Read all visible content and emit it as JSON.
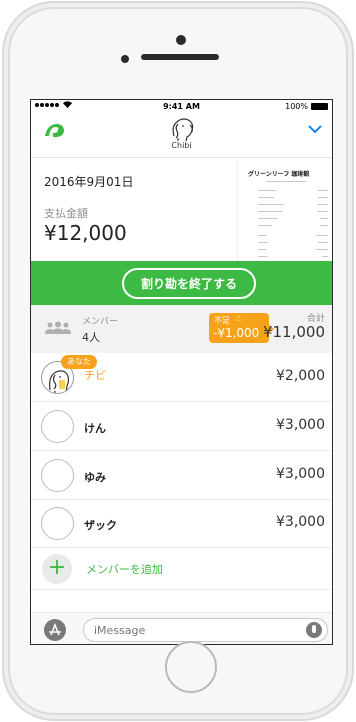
{
  "status": {
    "time": "9:41 AM",
    "battery": "100%",
    "wifi_icon": "wifi-icon"
  },
  "header": {
    "title": "Chibi",
    "icons": [
      "chibi-app-icon",
      "elephant-icon",
      "chevron-down-icon"
    ]
  },
  "receipt": {
    "date": "2016年9月01日",
    "pay_label": "支払金額",
    "pay_amount": "¥12,000",
    "thumbnail_title": "グリーンリーフ 珈琲館"
  },
  "action": {
    "end_button_label": "割り勘を終了する"
  },
  "summary": {
    "members_label": "メンバー",
    "members_count": "4人",
    "shortage_label": "不足",
    "shortage_amount": "-¥1,000",
    "total_label": "合計",
    "total_amount": "¥11,000"
  },
  "members": [
    {
      "name": "チビ",
      "amount": "¥2,000",
      "badge": "あなた",
      "is_me": true
    },
    {
      "name": "けん",
      "amount": "¥3,000"
    },
    {
      "name": "ゆみ",
      "amount": "¥3,000"
    },
    {
      "name": "ザック",
      "amount": "¥3,000"
    }
  ],
  "add_member_label": "メンバーを追加",
  "message_bar": {
    "placeholder": "iMessage"
  },
  "colors": {
    "accent_green": "#3dba43",
    "warning_orange": "#f7a21b",
    "ios_blue": "#1a82f0"
  }
}
